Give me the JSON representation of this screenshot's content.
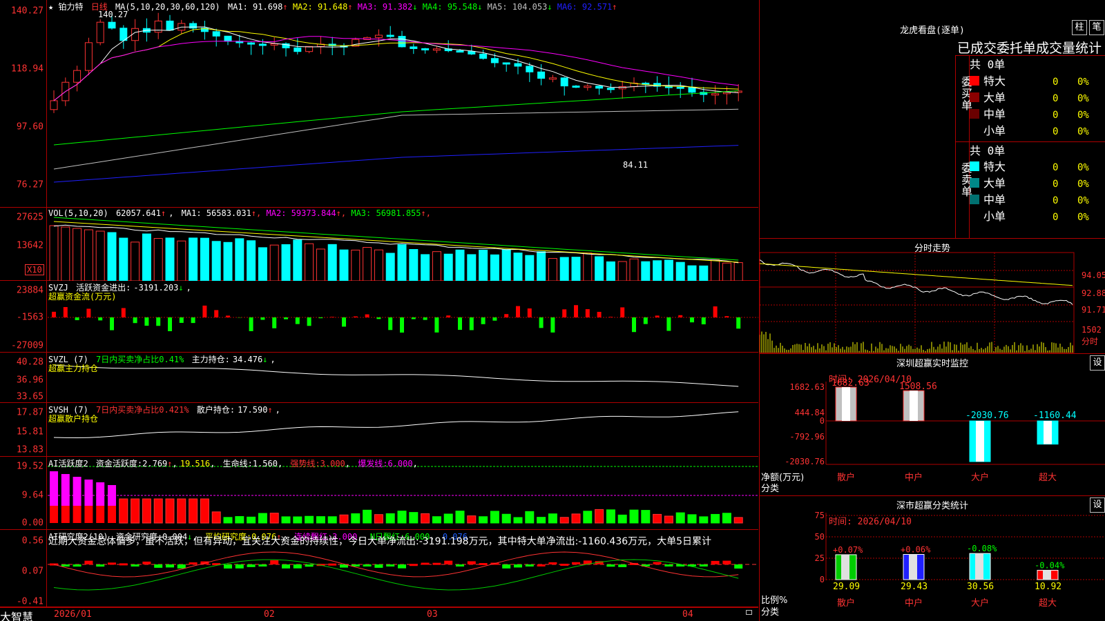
{
  "stock": {
    "name": "★ 铂力特",
    "period": "日线",
    "high_mark": "140.27",
    "low_mark": "84.11"
  },
  "ma": {
    "label": "MA(5,10,20,30,60,120)",
    "items": [
      {
        "name": "MA1",
        "value": "91.698",
        "arrow": "↑",
        "color": "#ffffff"
      },
      {
        "name": "MA2",
        "value": "91.648",
        "arrow": "↑",
        "color": "#ffff00"
      },
      {
        "name": "MA3",
        "value": "91.382",
        "arrow": "↓",
        "color": "#ff00ff"
      },
      {
        "name": "MA4",
        "value": "95.548",
        "arrow": "↓",
        "color": "#00ff00"
      },
      {
        "name": "MA5",
        "value": "104.053",
        "arrow": "↓",
        "color": "#c0c0c0"
      },
      {
        "name": "MA6",
        "value": "92.571",
        "arrow": "↑",
        "color": "#2020ff"
      }
    ]
  },
  "price_axis": [
    "140.27",
    "118.94",
    "97.60",
    "76.27"
  ],
  "vol": {
    "label": "VOL(5,10,20)",
    "value": "62057.641",
    "arrow": "↑",
    "ma": [
      {
        "name": "MA1",
        "value": "56583.031",
        "arrow": "↑",
        "color": "#ffffff"
      },
      {
        "name": "MA2",
        "value": "59373.844",
        "arrow": "↑",
        "color": "#ff00ff"
      },
      {
        "name": "MA3",
        "value": "56981.855",
        "arrow": "↑",
        "color": "#00ff00"
      }
    ],
    "axis": [
      "27625",
      "13642"
    ],
    "unit": "X10"
  },
  "svzj": {
    "label": "SVZJ",
    "text": "活跃资金进出:",
    "value": "-3191.203",
    "arrow": "↓",
    "sub": "超赢资金流(万元)",
    "axis": [
      "23884",
      "-1563",
      "-27009"
    ]
  },
  "svzl": {
    "label": "SVZL (7)",
    "t1": "7日内买卖净占比0.41%",
    "t2": "主力持仓:",
    "value": "34.476",
    "arrow": "↓",
    "sub": "超赢主力持仓",
    "axis": [
      "40.28",
      "36.96",
      "33.65"
    ]
  },
  "svsh": {
    "label": "SVSH (7)",
    "t1": "7日内买卖净占比0.421%",
    "t2": "散户持仓:",
    "value": "17.590",
    "arrow": "↑",
    "sub": "超赢散户持仓",
    "axis": [
      "17.87",
      "15.81",
      "13.83"
    ]
  },
  "ai1": {
    "label": "AI活跃度2",
    "t1": "资金活跃度:",
    "v1": "2.769",
    "a1": "↑",
    "v2": "19.516",
    "t3": "生命线:",
    "v3": "1.560",
    "t4": "强势线:",
    "v4": "3.000",
    "t5": "爆发线:",
    "v5": "6.000",
    "axis": [
      "19.52",
      "9.64",
      "0.00"
    ]
  },
  "ai2": {
    "label": "AI研究度2(10)",
    "t1": "资金研究度:",
    "v1": "0.004",
    "a1": "↓",
    "t2": "平均研究度:",
    "v2": "0.076",
    "a2": "↑",
    "t3": "连续飘红:",
    "v3": "3.000",
    "t4": "N日飘红:",
    "v4": "6.000",
    "v5": "0.076",
    "commentary": "近期大资金总体偏多，虽不活跃，但有异动，宜关注大资金的持续性，今日大单净流出:-3191.198万元，其中特大单净流出:-1160.436万元，大单5日累计",
    "axis": [
      "0.56",
      "0.07",
      "-0.41"
    ]
  },
  "xaxis": [
    "2026/01",
    "02",
    "03",
    "04"
  ],
  "brand": "大智慧",
  "longhu": {
    "title": "龙虎看盘(逐单)",
    "btn1": "柱",
    "btn2": "笔",
    "header": "已成交委托单成交量统计",
    "buy": {
      "label": "委买单",
      "total": "共 0单",
      "rows": [
        {
          "name": "特大",
          "count": "0",
          "pct": "0%",
          "color": "#ff0000"
        },
        {
          "name": "大单",
          "count": "0",
          "pct": "0%",
          "color": "#8b0000"
        },
        {
          "name": "中单",
          "count": "0",
          "pct": "0%",
          "color": "#6b0000"
        },
        {
          "name": "小单",
          "count": "0",
          "pct": "0%",
          "color": "#000000"
        }
      ]
    },
    "sell": {
      "label": "委卖单",
      "total": "共 0单",
      "rows": [
        {
          "name": "特大",
          "count": "0",
          "pct": "0%",
          "color": "#00ffff"
        },
        {
          "name": "大单",
          "count": "0",
          "pct": "0%",
          "color": "#008888"
        },
        {
          "name": "中单",
          "count": "0",
          "pct": "0%",
          "color": "#007070"
        },
        {
          "name": "小单",
          "count": "0",
          "pct": "0%",
          "color": "#000000"
        }
      ]
    }
  },
  "intraday": {
    "title": "分时走势",
    "axis": [
      "94.05",
      "92.88",
      "91.71"
    ],
    "vol_axis": "1502",
    "vol_unit": "分时"
  },
  "sz_monitor": {
    "title": "深圳超赢实时监控",
    "btn": "设",
    "time": "时间: 2026/04/10",
    "unit": "净额(万元)",
    "cat_label": "分类",
    "axis": [
      "1682.63",
      "444.84",
      "0",
      "-792.96",
      "-2030.76"
    ],
    "bars": [
      {
        "name": "散户",
        "value": "1682.63"
      },
      {
        "name": "中户",
        "value": "1508.56"
      },
      {
        "name": "大户",
        "value": "-2030.76"
      },
      {
        "name": "超大",
        "value": "-1160.44"
      }
    ]
  },
  "sz_stats": {
    "title": "深市超赢分类统计",
    "btn": "设",
    "time": "时间: 2026/04/10",
    "unit": "比例%",
    "cat_label": "分类",
    "axis": [
      "75",
      "50",
      "25",
      "0"
    ],
    "bars": [
      {
        "name": "散户",
        "value": "29.09",
        "chg": "+0.07%"
      },
      {
        "name": "中户",
        "value": "29.43",
        "chg": "+0.06%"
      },
      {
        "name": "大户",
        "value": "30.56",
        "chg": "-0.08%"
      },
      {
        "name": "超大",
        "value": "10.92",
        "chg": "-0.04%"
      }
    ]
  }
}
